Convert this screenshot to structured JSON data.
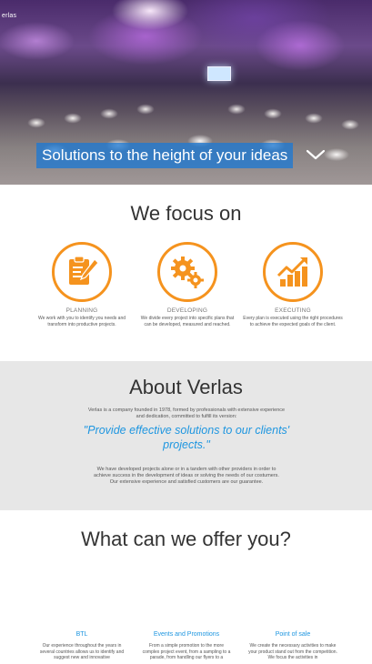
{
  "hero": {
    "logo": "erlas",
    "banner": "Solutions to the height of your ideas",
    "scroll_icon": "chevron-down-icon"
  },
  "focus": {
    "title": "We focus on",
    "accent_color": "#f5931e",
    "items": [
      {
        "icon": "clipboard-pencil-icon",
        "name": "PLANNING",
        "desc": "We work with you to identify you needs and transform into productive projects."
      },
      {
        "icon": "gears-icon",
        "name": "DEVELOPING",
        "desc": "We divide every project into specific plans that can be developed, measured and reached."
      },
      {
        "icon": "bar-chart-growth-icon",
        "name": "EXECUTING",
        "desc": "Every plan is executed using the right procedures to achieve the expected goals of the client."
      }
    ]
  },
  "about": {
    "title": "About Verlas",
    "p1": "Verlas is a company founded in 1978, formed by professionals with extensive experience and dedication, committed to fulfill its version:",
    "quote": "\"Provide effective solutions to our clients' projects.\"",
    "quote_color": "#1e96e0",
    "p2": "We have developed projects alone or in a tandem with other providers in order to achieve success in the development of ideas or solving the needs of our costumers. Our extensive experience and satisfied customers are our guarantee."
  },
  "offer": {
    "title": "What can we offer you?",
    "items": [
      {
        "name": "BTL",
        "desc": "Our experience throughout the years in several countries allows us to identify and suggest new and innovative"
      },
      {
        "name": "Events and Promotions",
        "desc": "From a simple promotion to the more complex project event, from a sampling to a parade, from handling our flyers to a"
      },
      {
        "name": "Point of sale",
        "desc": "We create the necessary activities to make your product stand out from the competition. We focus the activities in"
      }
    ]
  }
}
